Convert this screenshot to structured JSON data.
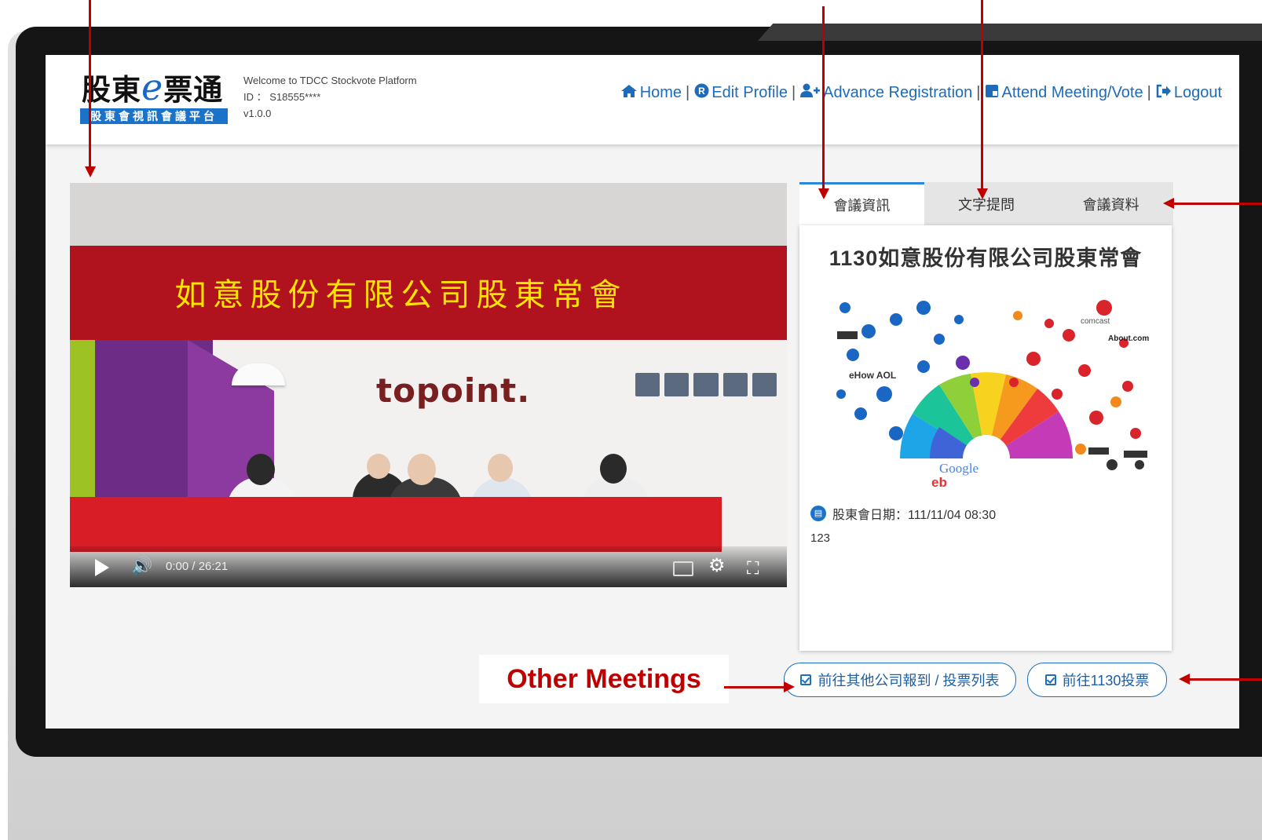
{
  "header": {
    "logo_main_1": "股東",
    "logo_e": "e",
    "logo_main_2": "票通",
    "logo_sub": "股東會視訊會議平台",
    "welcome": "Welcome to TDCC Stockvote Platform",
    "id_line": "ID ： S18555****",
    "version": "v1.0.0"
  },
  "nav": {
    "items": [
      {
        "label": "Home",
        "icon": "home-icon"
      },
      {
        "label": "Edit Profile",
        "icon": "registered-icon"
      },
      {
        "label": "Advance Registration",
        "icon": "user-plus-icon"
      },
      {
        "label": "Attend Meeting/Vote",
        "icon": "ballot-icon"
      },
      {
        "label": "Logout",
        "icon": "sign-out-icon"
      }
    ],
    "separator": "|"
  },
  "video": {
    "banner_text": "如意股份有限公司股東常會",
    "brand_text": "topoint.",
    "time": "0:00 / 26:21"
  },
  "tabs": [
    {
      "label": "會議資訊",
      "active": true
    },
    {
      "label": "文字提問",
      "active": false
    },
    {
      "label": "會議資料",
      "active": false
    }
  ],
  "panel": {
    "title": "1130如意股份有限公司股東常會",
    "date_label": "股東會日期：111/11/04 08:30",
    "description": "123"
  },
  "buttons": {
    "other_companies": "前往其他公司報到 / 投票列表",
    "vote": "前往1130投票"
  },
  "annotation": {
    "label": "Other Meetings",
    "color": "#c00000"
  },
  "colors": {
    "accent": "#1a73c9",
    "banner": "#b0131d",
    "banner_text": "#ffe400"
  }
}
